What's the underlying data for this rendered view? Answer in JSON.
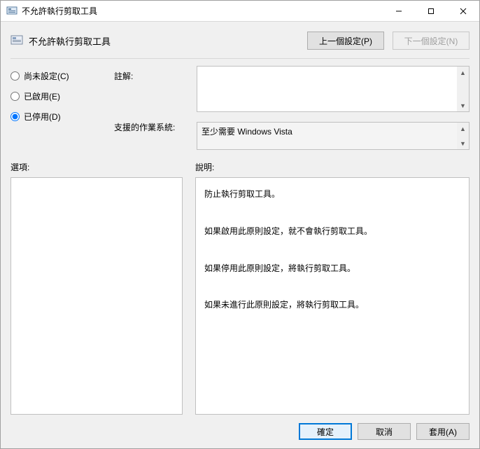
{
  "window": {
    "title": "不允許執行剪取工具"
  },
  "header": {
    "title": "不允許執行剪取工具",
    "prev": "上一個設定(P)",
    "next": "下一個設定(N)"
  },
  "radios": {
    "not_configured": "尚未設定(C)",
    "enabled": "已啟用(E)",
    "disabled": "已停用(D)",
    "selected": "disabled"
  },
  "labels": {
    "comment": "註解:",
    "supported": "支援的作業系統:",
    "options": "選項:",
    "help": "說明:"
  },
  "fields": {
    "comment_value": "",
    "supported_value": "至少需要 Windows Vista"
  },
  "help_text": "防止執行剪取工具。\n\n如果啟用此原則設定，就不會執行剪取工具。\n\n如果停用此原則設定，將執行剪取工具。\n\n如果未進行此原則設定，將執行剪取工具。",
  "footer": {
    "ok": "確定",
    "cancel": "取消",
    "apply": "套用(A)"
  },
  "icons": {
    "app": "gpedit-icon"
  }
}
